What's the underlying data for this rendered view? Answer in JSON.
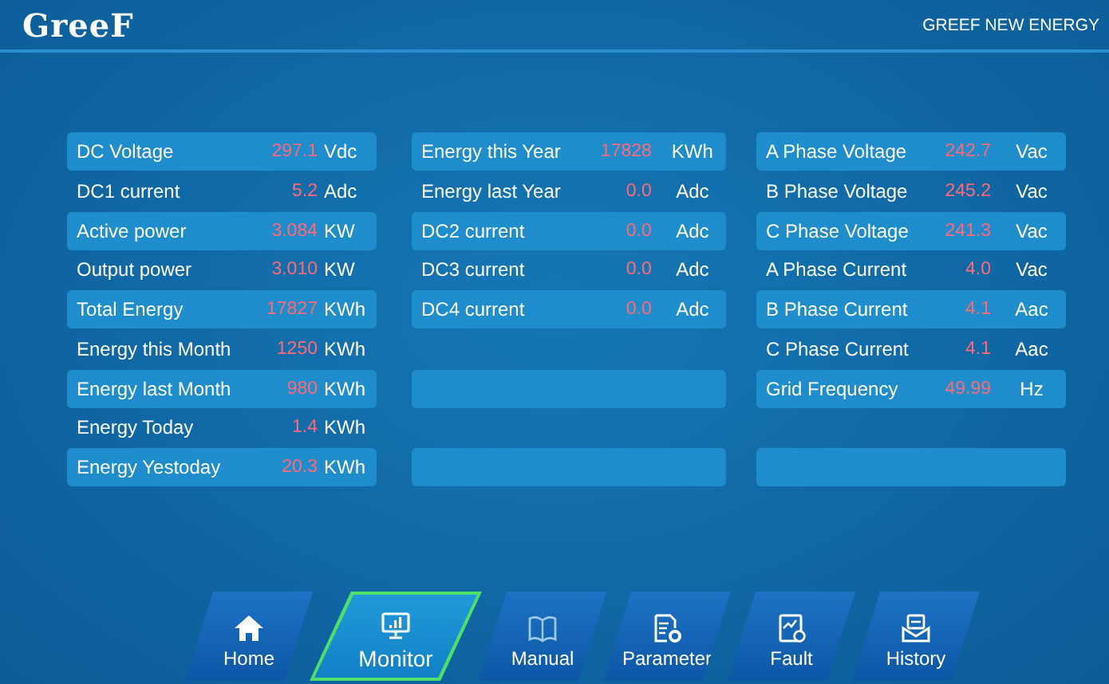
{
  "header": {
    "logo": "GreeF",
    "title": "GREEF NEW ENERGY"
  },
  "columns": [
    {
      "rows": [
        {
          "label": "DC Voltage",
          "value": "297.1",
          "unit": "Vdc"
        },
        {
          "label": "DC1 current",
          "value": "5.2",
          "unit": "Adc"
        },
        {
          "label": "Active power",
          "value": "3.084",
          "unit": "KW"
        },
        {
          "label": "Output power",
          "value": "3.010",
          "unit": "KW"
        },
        {
          "label": "Total Energy",
          "value": "17827",
          "unit": "KWh"
        },
        {
          "label": "Energy this Month",
          "value": "1250",
          "unit": "KWh"
        },
        {
          "label": "Energy last Month",
          "value": "980",
          "unit": "KWh"
        },
        {
          "label": "Energy Today",
          "value": "1.4",
          "unit": "KWh"
        },
        {
          "label": "Energy Yestoday",
          "value": "20.3",
          "unit": "KWh"
        }
      ]
    },
    {
      "rows": [
        {
          "label": "Energy this Year",
          "value": "17828",
          "unit": "KWh"
        },
        {
          "label": "Energy last Year",
          "value": "0.0",
          "unit": "Adc"
        },
        {
          "label": "DC2 current",
          "value": "0.0",
          "unit": "Adc"
        },
        {
          "label": "DC3 current",
          "value": "0.0",
          "unit": "Adc"
        },
        {
          "label": "DC4 current",
          "value": "0.0",
          "unit": "Adc"
        }
      ]
    },
    {
      "rows": [
        {
          "label": "A Phase Voltage",
          "value": "242.7",
          "unit": "Vac"
        },
        {
          "label": "B Phase Voltage",
          "value": "245.2",
          "unit": "Vac"
        },
        {
          "label": "C Phase Voltage",
          "value": "241.3",
          "unit": "Vac"
        },
        {
          "label": "A Phase Current",
          "value": "4.0",
          "unit": "Vac"
        },
        {
          "label": "B Phase Current",
          "value": "4.1",
          "unit": "Aac"
        },
        {
          "label": "C Phase Current",
          "value": "4.1",
          "unit": "Aac"
        },
        {
          "label": "Grid Frequency",
          "value": "49.99",
          "unit": "Hz"
        }
      ]
    }
  ],
  "nav": [
    {
      "kind": "home",
      "label": "Home",
      "selected": false
    },
    {
      "kind": "monitor",
      "label": "Monitor",
      "selected": true
    },
    {
      "kind": "manual",
      "label": "Manual",
      "selected": false
    },
    {
      "kind": "parameter",
      "label": "Parameter",
      "selected": false
    },
    {
      "kind": "fault",
      "label": "Fault",
      "selected": false
    },
    {
      "kind": "history",
      "label": "History",
      "selected": false
    }
  ]
}
